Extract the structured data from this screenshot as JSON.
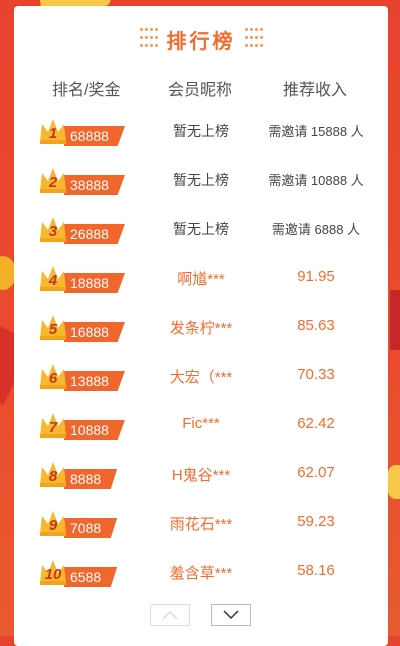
{
  "title": "排行榜",
  "header": {
    "rank": "排名/奖金",
    "nickname": "会员昵称",
    "income": "推荐收入"
  },
  "rows": [
    {
      "rank": "1",
      "prize": "68888",
      "nickname": "暂无上榜",
      "income": "需邀请 15888 人",
      "empty": true
    },
    {
      "rank": "2",
      "prize": "38888",
      "nickname": "暂无上榜",
      "income": "需邀请 10888 人",
      "empty": true
    },
    {
      "rank": "3",
      "prize": "26888",
      "nickname": "暂无上榜",
      "income": "需邀请 6888 人",
      "empty": true
    },
    {
      "rank": "4",
      "prize": "18888",
      "nickname": "啊馗***",
      "income": "91.95",
      "empty": false
    },
    {
      "rank": "5",
      "prize": "16888",
      "nickname": "发条柠***",
      "income": "85.63",
      "empty": false
    },
    {
      "rank": "6",
      "prize": "13888",
      "nickname": "大宏（***",
      "income": "70.33",
      "empty": false
    },
    {
      "rank": "7",
      "prize": "10888",
      "nickname": "Fic***",
      "income": "62.42",
      "empty": false
    },
    {
      "rank": "8",
      "prize": "8888",
      "nickname": "H鬼谷***",
      "income": "62.07",
      "empty": false
    },
    {
      "rank": "9",
      "prize": "7088",
      "nickname": "雨花石***",
      "income": "59.23",
      "empty": false
    },
    {
      "rank": "10",
      "prize": "6588",
      "nickname": "羞含草***",
      "income": "58.16",
      "empty": false
    }
  ],
  "icons": {
    "crown": "crown-icon",
    "up": "chevron-up-icon",
    "down": "chevron-down-icon"
  },
  "colors": {
    "accent": "#f26d2f",
    "badge": "#f0662d",
    "crown": "#f5b82e",
    "background": "#e8432f"
  }
}
